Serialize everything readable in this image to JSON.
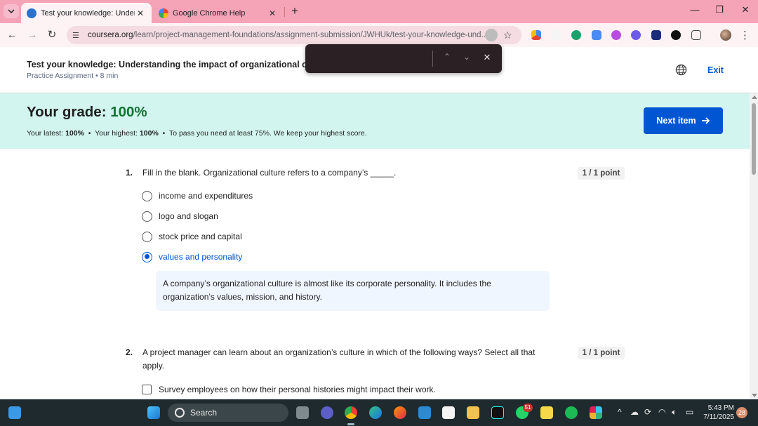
{
  "browser": {
    "tabs": [
      {
        "title": "Test your knowledge: Understa",
        "active": true
      },
      {
        "title": "Google Chrome Help",
        "active": false
      }
    ],
    "url_domain": "coursera.org",
    "url_path": "/learn/project-management-foundations/assignment-submission/JWHUk/test-your-knowledge-und...",
    "colors": {
      "tabstrip": "#f5a3b7",
      "toolbar": "#fdf3f5"
    }
  },
  "header": {
    "assignment_title": "Test your knowledge: Understanding the impact of organizational culture",
    "assignment_meta": "Practice Assignment • 8 min",
    "exit_label": "Exit"
  },
  "grade": {
    "label": "Your grade: ",
    "value": "100%",
    "latest_label": "Your latest: ",
    "latest_value": "100%",
    "highest_label": "Your highest: ",
    "highest_value": "100%",
    "pass_note": "To pass you need at least 75%. We keep your highest score.",
    "next_button": "Next item"
  },
  "questions": [
    {
      "number": "1.",
      "text": "Fill in the blank. Organizational culture refers to a company’s _____.",
      "points": "1 / 1 point",
      "options": [
        {
          "label": "income and expenditures",
          "selected": false
        },
        {
          "label": "logo and slogan",
          "selected": false
        },
        {
          "label": "stock price and capital",
          "selected": false
        },
        {
          "label": "values and personality",
          "selected": true
        }
      ],
      "feedback_line1": "A company’s organizational culture is almost like its corporate personality. It includes the",
      "feedback_line2": "organization’s values, mission, and history."
    },
    {
      "number": "2.",
      "text_line1": "A project manager can learn about an organization’s culture in which of the following ways? Select all that",
      "text_line2": "apply.",
      "points": "1 / 1 point",
      "options": [
        {
          "label": "Survey employees on how their personal histories might impact their work.",
          "selected": false
        }
      ]
    }
  ],
  "taskbar": {
    "search_label": "Search",
    "time": "5:43 PM",
    "date": "7/11/2025",
    "whatsapp_badge": "51",
    "notification_count": "28"
  }
}
